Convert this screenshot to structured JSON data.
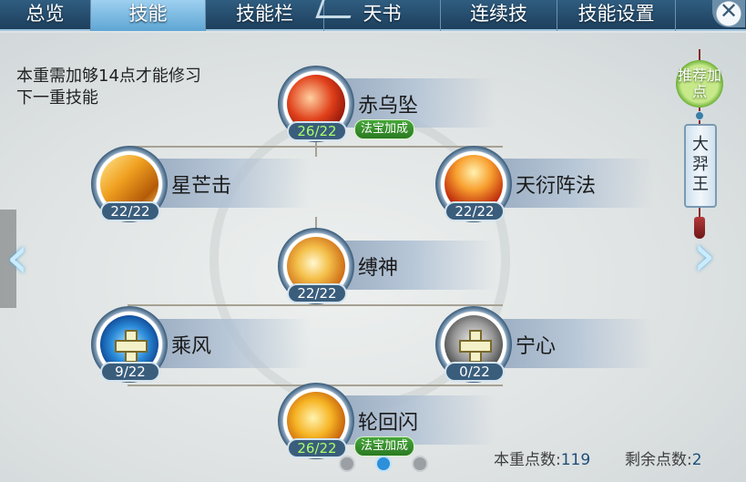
{
  "tabs": [
    {
      "label": "总览",
      "active": false
    },
    {
      "label": "技能",
      "active": true
    },
    {
      "label": "技能栏",
      "active": false
    },
    {
      "label": "天书",
      "active": false
    },
    {
      "label": "连续技",
      "active": false
    },
    {
      "label": "技能设置",
      "active": false
    }
  ],
  "close_label": "✕",
  "hint_text": "本重需加够14点才能修习下一重技能",
  "recommend_label": "推荐加点",
  "tag_label": "大羿王",
  "skills": [
    {
      "name": "赤乌坠",
      "level": "26/22",
      "bonus": "法宝加成",
      "icon": "red-flame-icon"
    },
    {
      "name": "星芒击",
      "level": "22/22",
      "icon": "golden-slash-icon"
    },
    {
      "name": "天衍阵法",
      "level": "22/22",
      "icon": "fire-sword-icon"
    },
    {
      "name": "缚神",
      "level": "22/22",
      "icon": "golden-orb-icon"
    },
    {
      "name": "乘风",
      "level": "9/22",
      "icon": "blue-wind-icon"
    },
    {
      "name": "宁心",
      "level": "0/22",
      "icon": "gray-orb-icon"
    },
    {
      "name": "轮回闪",
      "level": "26/22",
      "bonus": "法宝加成",
      "icon": "golden-flash-icon"
    }
  ],
  "footer": {
    "points_label": "本重点数:",
    "points_value": "119",
    "remaining_label": "剩余点数:",
    "remaining_value": "2"
  },
  "pager": {
    "pages": 3,
    "current": 2
  },
  "colors": {
    "accent": "#2d90d9",
    "level_green": "#a8ff6a",
    "bonus_green": "#46a53a"
  }
}
